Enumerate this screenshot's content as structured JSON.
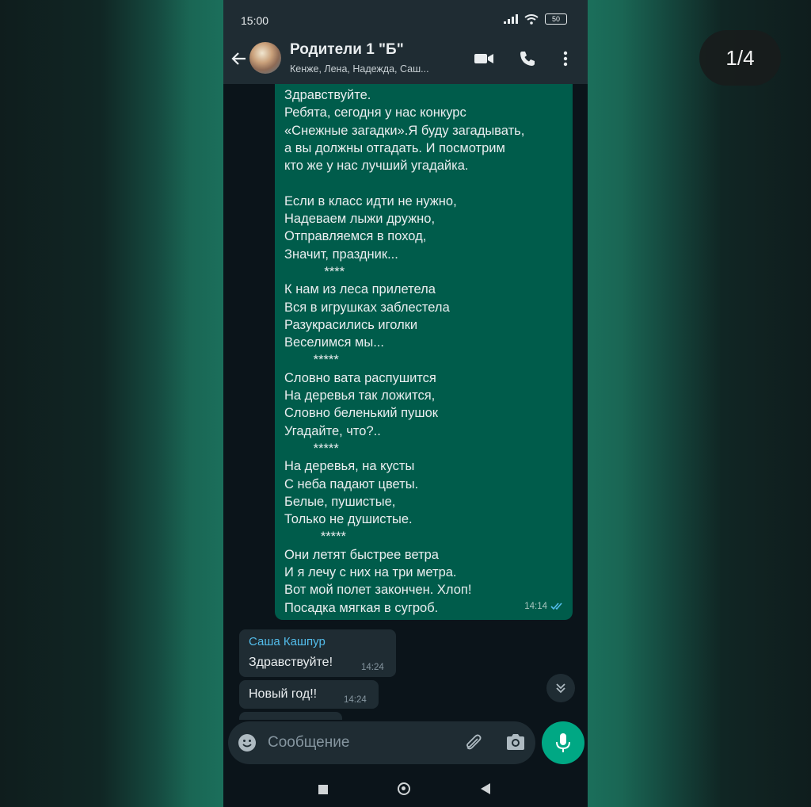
{
  "viewer": {
    "counter": "1/4"
  },
  "status_bar": {
    "time": "15:00",
    "battery": "50"
  },
  "header": {
    "title": "Родители 1 \"Б\"",
    "subtitle": "Кенже, Лена, Надежда, Саш..."
  },
  "messages": {
    "outgoing": {
      "text": "Здравствуйте.\nРебята, сегодня у нас конкурс\n«Снежные загадки».Я буду загадывать,\nа вы должны отгадать. И посмотрим\nкто же у нас лучший угадайка.\n\nЕсли в класс идти не нужно,\nНадеваем лыжи дружно,\nОтправляемся в поход,\nЗначит, праздник...\n           ****\nК нам из леса прилетела\nВся в игрушках заблестела\nРазукрасились иголки\nВеселимся мы...\n        *****\nСловно вата распушится\nНа деревья так ложится,\nСловно беленький пушок\nУгадайте, что?..\n        *****\nНа деревья, на кусты\nС неба падают цветы.\nБелые, пушистые,\nТолько не душистые.\n          *****\nОни летят быстрее ветра\nИ я лечу с них на три метра.\nВот мой полет закончен. Хлоп!\nПосадка мягкая в сугроб.",
      "time": "14:14"
    },
    "incoming_1": {
      "sender": "Саша Кашпур",
      "text": "Здравствуйте!",
      "time": "14:24"
    },
    "incoming_2": {
      "text": "Новый год!!",
      "time": "14:24"
    }
  },
  "composer": {
    "placeholder": "Сообщение"
  },
  "colors": {
    "header_bg": "#1f2c33",
    "chat_bg": "#0b141a",
    "outgoing_bubble": "#005c4b",
    "incoming_bubble": "#1f2c33",
    "accent": "#00a884",
    "sender_name": "#53bdeb"
  },
  "icons": {
    "back": "arrow-left-icon",
    "video": "video-call-icon",
    "call": "phone-icon",
    "menu": "more-vert-icon",
    "emoji": "emoji-icon",
    "attach": "paperclip-icon",
    "camera": "camera-icon",
    "mic": "microphone-icon",
    "scroll": "chevron-double-down-icon"
  }
}
